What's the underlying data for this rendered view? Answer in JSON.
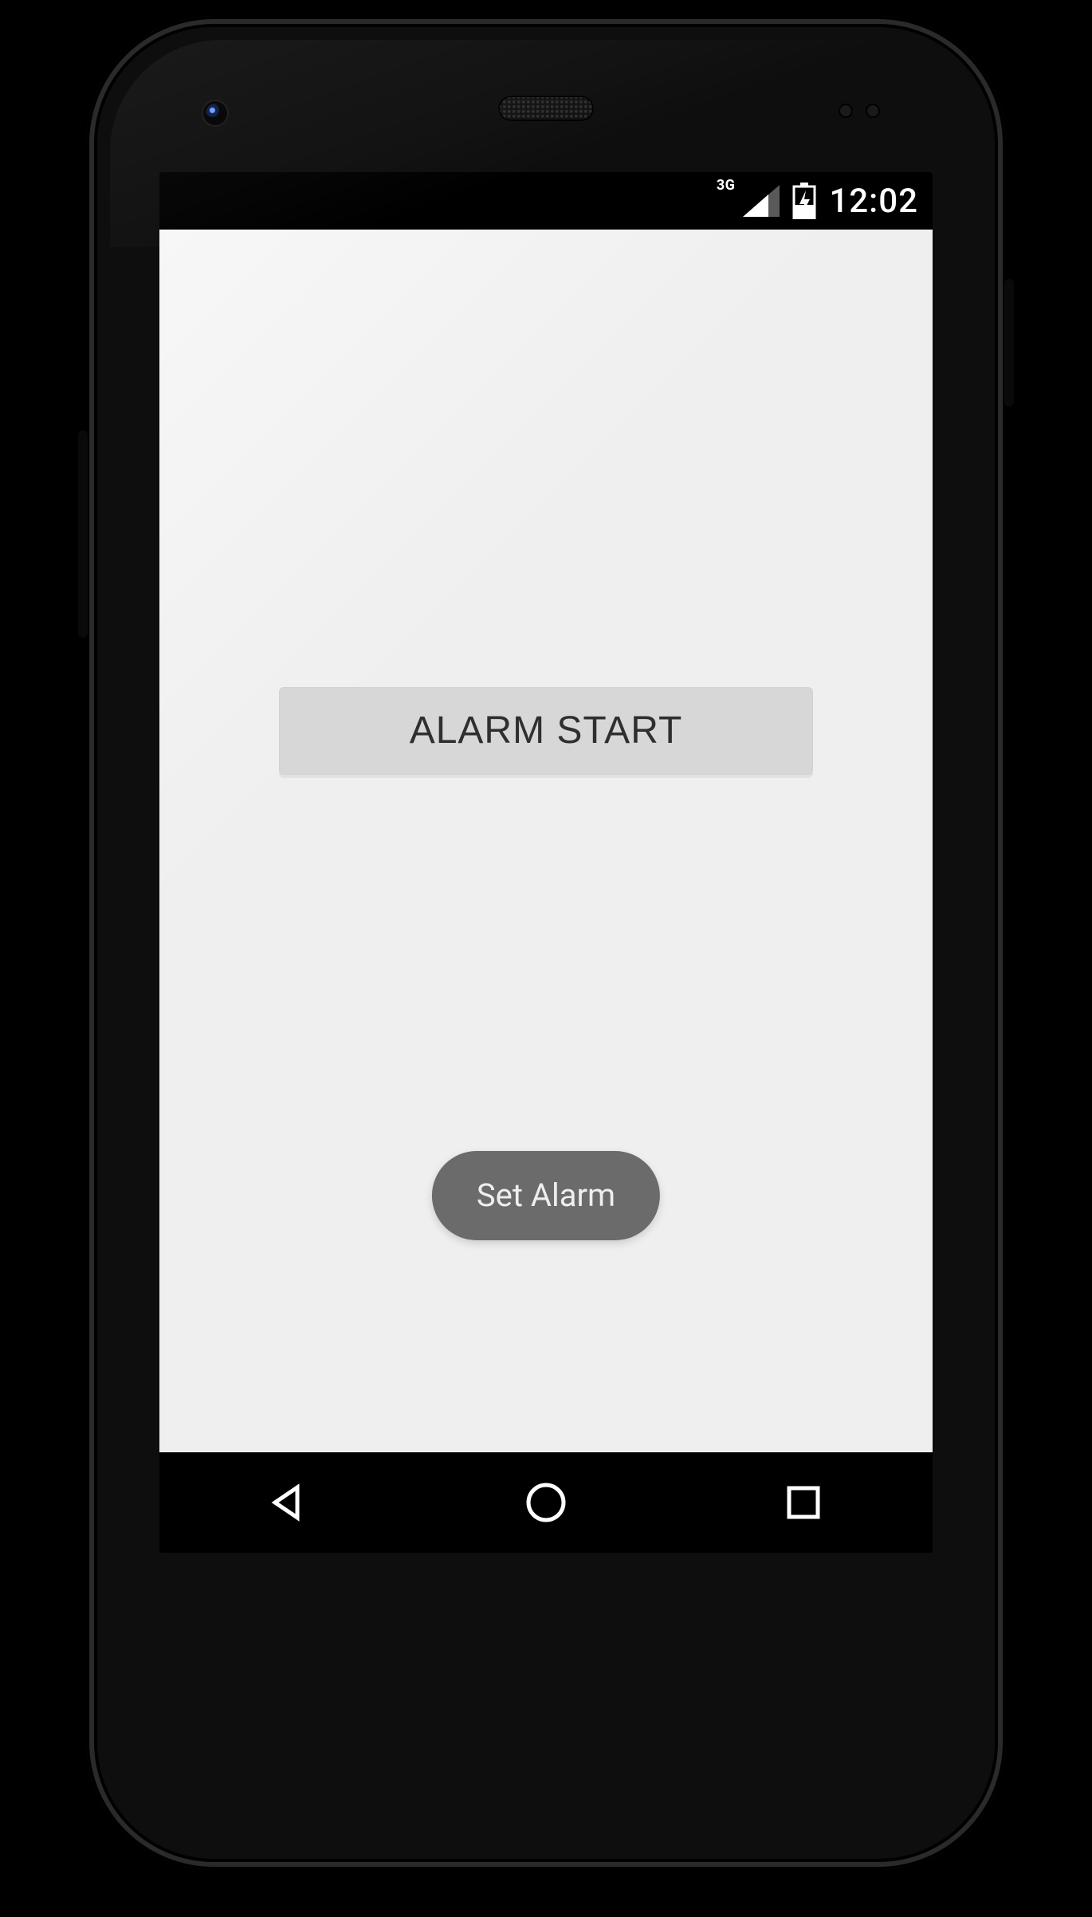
{
  "statusbar": {
    "network_badge": "3G",
    "clock": "12:02"
  },
  "main": {
    "alarm_button_label": "ALARM START",
    "toast_text": "Set Alarm"
  },
  "icons": {
    "signal": "signal-icon",
    "battery": "battery-charging-icon",
    "nav_back": "back-icon",
    "nav_home": "home-icon",
    "nav_recent": "recent-apps-icon"
  }
}
